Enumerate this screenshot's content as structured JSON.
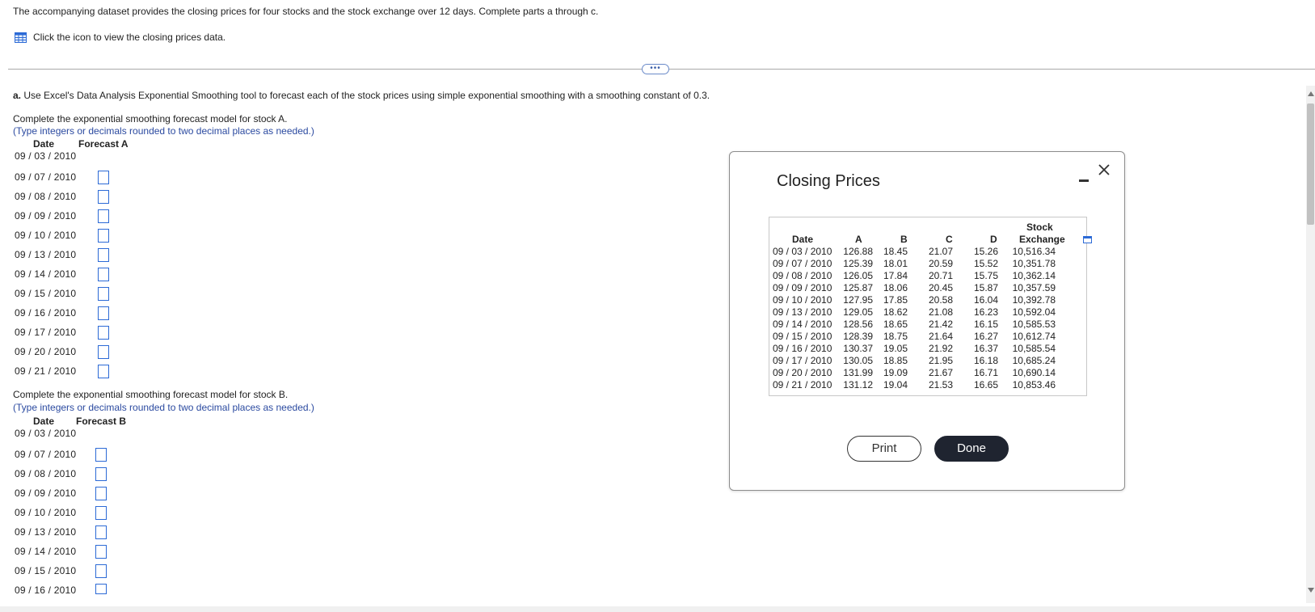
{
  "intro": "The accompanying dataset provides the closing prices for four stocks and the stock exchange over 12 days. Complete parts a through c.",
  "data_link": "Click the icon to view the closing prices data.",
  "expander_label": "•••",
  "part_a": {
    "label": "a.",
    "text": "Use Excel's Data Analysis Exponential Smoothing tool to forecast each of the stock prices using simple exponential smoothing with a smoothing constant of 0.3."
  },
  "stock_a": {
    "instruction": "Complete the exponential smoothing forecast model for stock A.",
    "hint": "(Type integers or decimals rounded to two decimal places as needed.)",
    "col_date": "Date",
    "col_forecast": "Forecast A",
    "dates": [
      "09 / 03 / 2010",
      "09 / 07 / 2010",
      "09 / 08 / 2010",
      "09 / 09 / 2010",
      "09 / 10 / 2010",
      "09 / 13 / 2010",
      "09 / 14 / 2010",
      "09 / 15 / 2010",
      "09 / 16 / 2010",
      "09 / 17 / 2010",
      "09 / 20 / 2010",
      "09 / 21 / 2010"
    ]
  },
  "stock_b": {
    "instruction": "Complete the exponential smoothing forecast model for stock B.",
    "hint": "(Type integers or decimals rounded to two decimal places as needed.)",
    "col_date": "Date",
    "col_forecast": "Forecast B",
    "dates": [
      "09 / 03 / 2010",
      "09 / 07 / 2010",
      "09 / 08 / 2010",
      "09 / 09 / 2010",
      "09 / 10 / 2010",
      "09 / 13 / 2010",
      "09 / 14 / 2010",
      "09 / 15 / 2010",
      "09 / 16 / 2010"
    ]
  },
  "dialog": {
    "title": "Closing Prices",
    "minimize": "-",
    "close": "✕",
    "print_label": "Print",
    "done_label": "Done",
    "table": {
      "headers": {
        "date": "Date",
        "a": "A",
        "b": "B",
        "c": "C",
        "d": "D",
        "ex_top": "Stock",
        "ex_bottom": "Exchange"
      },
      "rows": [
        [
          "09 / 03 / 2010",
          "126.88",
          "18.45",
          "21.07",
          "15.26",
          "10,516.34"
        ],
        [
          "09 / 07 / 2010",
          "125.39",
          "18.01",
          "20.59",
          "15.52",
          "10,351.78"
        ],
        [
          "09 / 08 / 2010",
          "126.05",
          "17.84",
          "20.71",
          "15.75",
          "10,362.14"
        ],
        [
          "09 / 09 / 2010",
          "125.87",
          "18.06",
          "20.45",
          "15.87",
          "10,357.59"
        ],
        [
          "09 / 10 / 2010",
          "127.95",
          "17.85",
          "20.58",
          "16.04",
          "10,392.78"
        ],
        [
          "09 / 13 / 2010",
          "129.05",
          "18.62",
          "21.08",
          "16.23",
          "10,592.04"
        ],
        [
          "09 / 14 / 2010",
          "128.56",
          "18.65",
          "21.42",
          "16.15",
          "10,585.53"
        ],
        [
          "09 / 15 / 2010",
          "128.39",
          "18.75",
          "21.64",
          "16.27",
          "10,612.74"
        ],
        [
          "09 / 16 / 2010",
          "130.37",
          "19.05",
          "21.92",
          "16.37",
          "10,585.54"
        ],
        [
          "09 / 17 / 2010",
          "130.05",
          "18.85",
          "21.95",
          "16.18",
          "10,685.24"
        ],
        [
          "09 / 20 / 2010",
          "131.99",
          "19.09",
          "21.67",
          "16.71",
          "10,690.14"
        ],
        [
          "09 / 21 / 2010",
          "131.12",
          "19.04",
          "21.53",
          "16.65",
          "10,853.46"
        ]
      ]
    }
  },
  "colors": {
    "accent": "#2c6ad6",
    "hint": "#2b4aa0",
    "done_bg": "#1f2430"
  }
}
